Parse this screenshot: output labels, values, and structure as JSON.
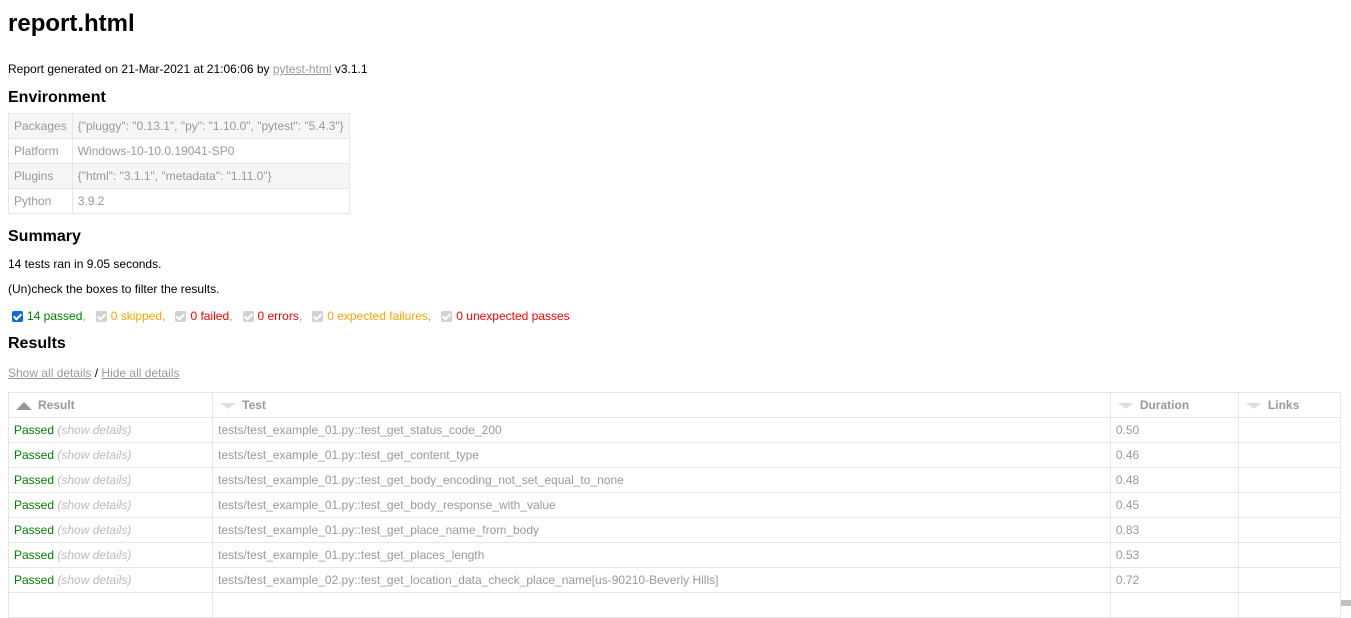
{
  "title": "report.html",
  "generated": {
    "prefix": "Report generated on 21-Mar-2021 at 21:06:06 by ",
    "link": "pytest-html",
    "suffix": " v3.1.1"
  },
  "environment": {
    "heading": "Environment",
    "rows": [
      {
        "key": "Packages",
        "value": "{\"pluggy\": \"0.13.1\", \"py\": \"1.10.0\", \"pytest\": \"5.4.3\"}"
      },
      {
        "key": "Platform",
        "value": "Windows-10-10.0.19041-SP0"
      },
      {
        "key": "Plugins",
        "value": "{\"html\": \"3.1.1\", \"metadata\": \"1.11.0\"}"
      },
      {
        "key": "Python",
        "value": "3.9.2"
      }
    ]
  },
  "summary": {
    "heading": "Summary",
    "ran": "14 tests ran in 9.05 seconds.",
    "instructions": "(Un)check the boxes to filter the results.",
    "filters": [
      {
        "label": "14 passed",
        "checked": true,
        "cls": "passed"
      },
      {
        "label": "0 skipped",
        "checked": true,
        "cls": "skipped"
      },
      {
        "label": "0 failed",
        "checked": true,
        "cls": "failed"
      },
      {
        "label": "0 errors",
        "checked": true,
        "cls": "error"
      },
      {
        "label": "0 expected failures",
        "checked": true,
        "cls": "xfailed"
      },
      {
        "label": "0 unexpected passes",
        "checked": true,
        "cls": "xpassed"
      }
    ]
  },
  "results": {
    "heading": "Results",
    "show_all": "Show all details",
    "separator": " / ",
    "hide_all": "Hide all details",
    "columns": [
      "Result",
      "Test",
      "Duration",
      "Links"
    ],
    "rows": [
      {
        "result": "Passed",
        "details": "(show details)",
        "test": "tests/test_example_01.py::test_get_status_code_200",
        "duration": "0.50",
        "links": ""
      },
      {
        "result": "Passed",
        "details": "(show details)",
        "test": "tests/test_example_01.py::test_get_content_type",
        "duration": "0.46",
        "links": ""
      },
      {
        "result": "Passed",
        "details": "(show details)",
        "test": "tests/test_example_01.py::test_get_body_encoding_not_set_equal_to_none",
        "duration": "0.48",
        "links": ""
      },
      {
        "result": "Passed",
        "details": "(show details)",
        "test": "tests/test_example_01.py::test_get_body_response_with_value",
        "duration": "0.45",
        "links": ""
      },
      {
        "result": "Passed",
        "details": "(show details)",
        "test": "tests/test_example_01.py::test_get_place_name_from_body",
        "duration": "0.83",
        "links": ""
      },
      {
        "result": "Passed",
        "details": "(show details)",
        "test": "tests/test_example_01.py::test_get_places_length",
        "duration": "0.53",
        "links": ""
      },
      {
        "result": "Passed",
        "details": "(show details)",
        "test": "tests/test_example_02.py::test_get_location_data_check_place_name[us-90210-Beverly Hills]",
        "duration": "0.72",
        "links": ""
      }
    ]
  }
}
